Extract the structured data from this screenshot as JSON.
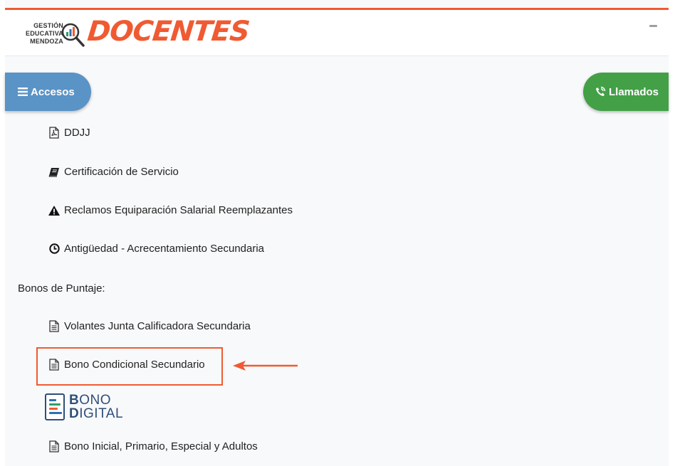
{
  "header": {
    "brand_line1": "GESTIÓN",
    "brand_line2": "EDUCATIVA",
    "brand_line3": "MENDOZA",
    "brand_title": "DOCENTES",
    "accent_color": "#f05a32"
  },
  "buttons": {
    "accesos_label": "Accesos",
    "llamados_label": "Llamados",
    "accesos_color": "#5a93c6",
    "llamados_color": "#43a047"
  },
  "items": [
    {
      "label": "DDJJ",
      "icon": "pdf-file-icon"
    },
    {
      "label": "Certificación de Servicio",
      "icon": "book-icon"
    },
    {
      "label": "Reclamos Equiparación Salarial Reemplazantes",
      "icon": "warning-icon"
    },
    {
      "label": "Antigüedad - Acrecentamiento Secundaria",
      "icon": "clock-icon"
    }
  ],
  "section_title": "Bonos de Puntaje:",
  "bonos": [
    {
      "label": "Volantes Junta Calificadora Secundaria",
      "icon": "document-icon"
    },
    {
      "label": "Bono Condicional Secundario",
      "icon": "document-icon"
    },
    {
      "label": "Bono Inicial, Primario, Especial y Adultos",
      "icon": "document-icon"
    }
  ],
  "bono_digital": {
    "line1_bold": "B",
    "line1_rest": "ONO",
    "line2_bold": "D",
    "line2_rest": "IGITAL"
  }
}
